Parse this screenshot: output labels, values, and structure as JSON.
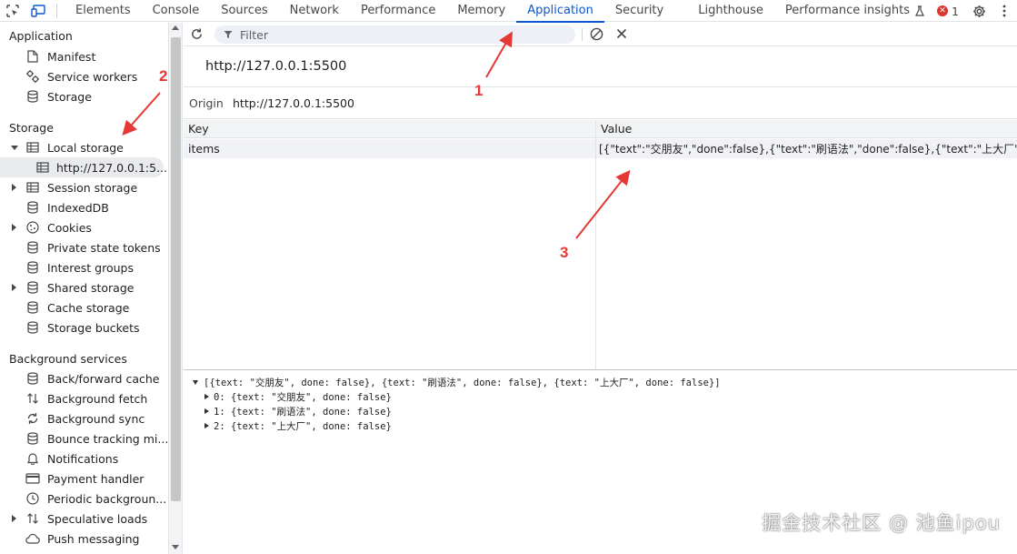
{
  "topbar": {
    "tabs": [
      "Elements",
      "Console",
      "Sources",
      "Network",
      "Performance",
      "Memory",
      "Application",
      "Security",
      "Lighthouse",
      "Performance insights"
    ],
    "active_tab": "Application",
    "error_count": "1"
  },
  "sidebar": {
    "application_title": "Application",
    "application_items": [
      "Manifest",
      "Service workers",
      "Storage"
    ],
    "storage_title": "Storage",
    "storage_items": {
      "local_storage": "Local storage",
      "local_origin": "http://127.0.0.1:5...",
      "session_storage": "Session storage",
      "indexeddb": "IndexedDB",
      "cookies": "Cookies",
      "private_state_tokens": "Private state tokens",
      "interest_groups": "Interest groups",
      "shared_storage": "Shared storage",
      "cache_storage": "Cache storage",
      "storage_buckets": "Storage buckets"
    },
    "background_title": "Background services",
    "background_items": [
      "Back/forward cache",
      "Background fetch",
      "Background sync",
      "Bounce tracking mi...",
      "Notifications",
      "Payment handler",
      "Periodic backgroun...",
      "Speculative loads",
      "Push messaging"
    ]
  },
  "main": {
    "filter_placeholder": "Filter",
    "origin_title": "http://127.0.0.1:5500",
    "origin_label": "Origin",
    "origin_value": "http://127.0.0.1:5500",
    "table": {
      "headers": [
        "Key",
        "Value"
      ],
      "rows": [
        {
          "key": "items",
          "value": "[{\"text\":\"交朋友\",\"done\":false},{\"text\":\"刷语法\",\"done\":false},{\"text\":\"上大厂\",\"d..."
        }
      ]
    },
    "preview": {
      "root": "[{text: \"交朋友\", done: false}, {text: \"刷语法\", done: false}, {text: \"上大厂\", done: false}]",
      "children": [
        "0: {text: \"交朋友\", done: false}",
        "1: {text: \"刷语法\", done: false}",
        "2: {text: \"上大厂\", done: false}"
      ]
    }
  },
  "annotations": [
    "1",
    "2",
    "3"
  ],
  "watermark": "掘金技术社区 @ 池鱼ipou",
  "colors": {
    "accent": "#0b57d0",
    "annotation": "#e53935",
    "error": "#dc362e"
  }
}
